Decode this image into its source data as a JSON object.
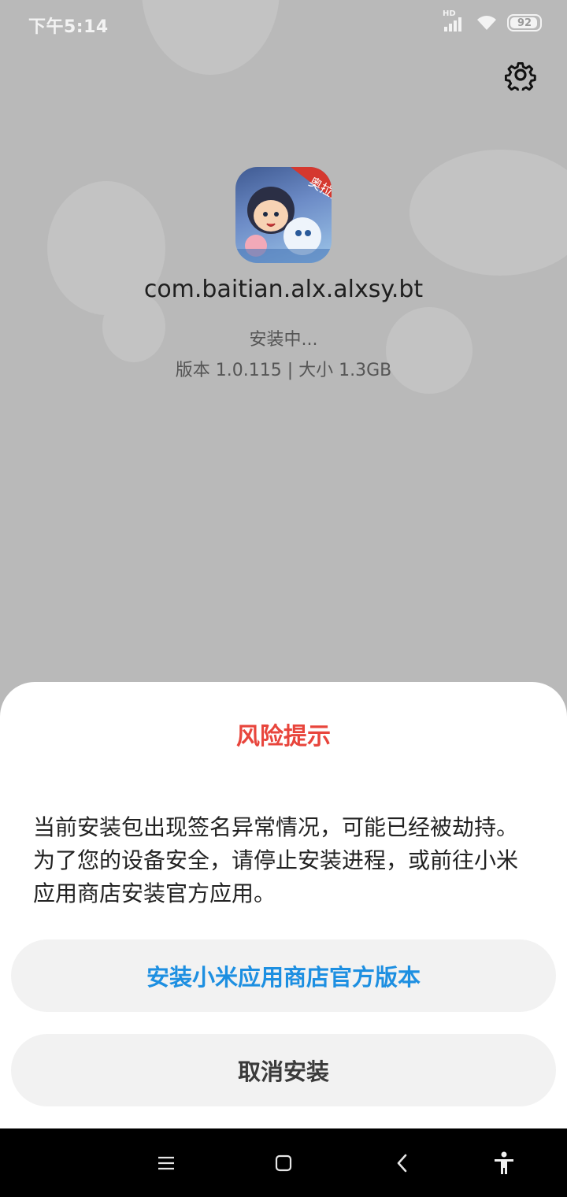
{
  "status_bar": {
    "time": "下午5:14",
    "network_label": "HD",
    "battery_level": "92"
  },
  "installer": {
    "package_name": "com.baitian.alx.alxsy.bt",
    "status": "安装中...",
    "version_info": "版本 1.0.115 | 大小 1.3GB",
    "icon_badge": "奥拉星"
  },
  "risk_dialog": {
    "title": "风险提示",
    "message": "当前安装包出现签名异常情况，可能已经被劫持。为了您的设备安全，请停止安装进程，或前往小米应用商店安装官方应用。",
    "primary_button": "安装小米应用商店官方版本",
    "cancel_button": "取消安装"
  },
  "icons": {
    "settings": "gear-icon",
    "menu": "menu-icon",
    "home": "home-icon",
    "back": "back-icon",
    "accessibility": "accessibility-icon"
  },
  "colors": {
    "title_red": "#e8453c",
    "primary_blue": "#1d8fe1",
    "dim_background": "#b9b9b9"
  }
}
